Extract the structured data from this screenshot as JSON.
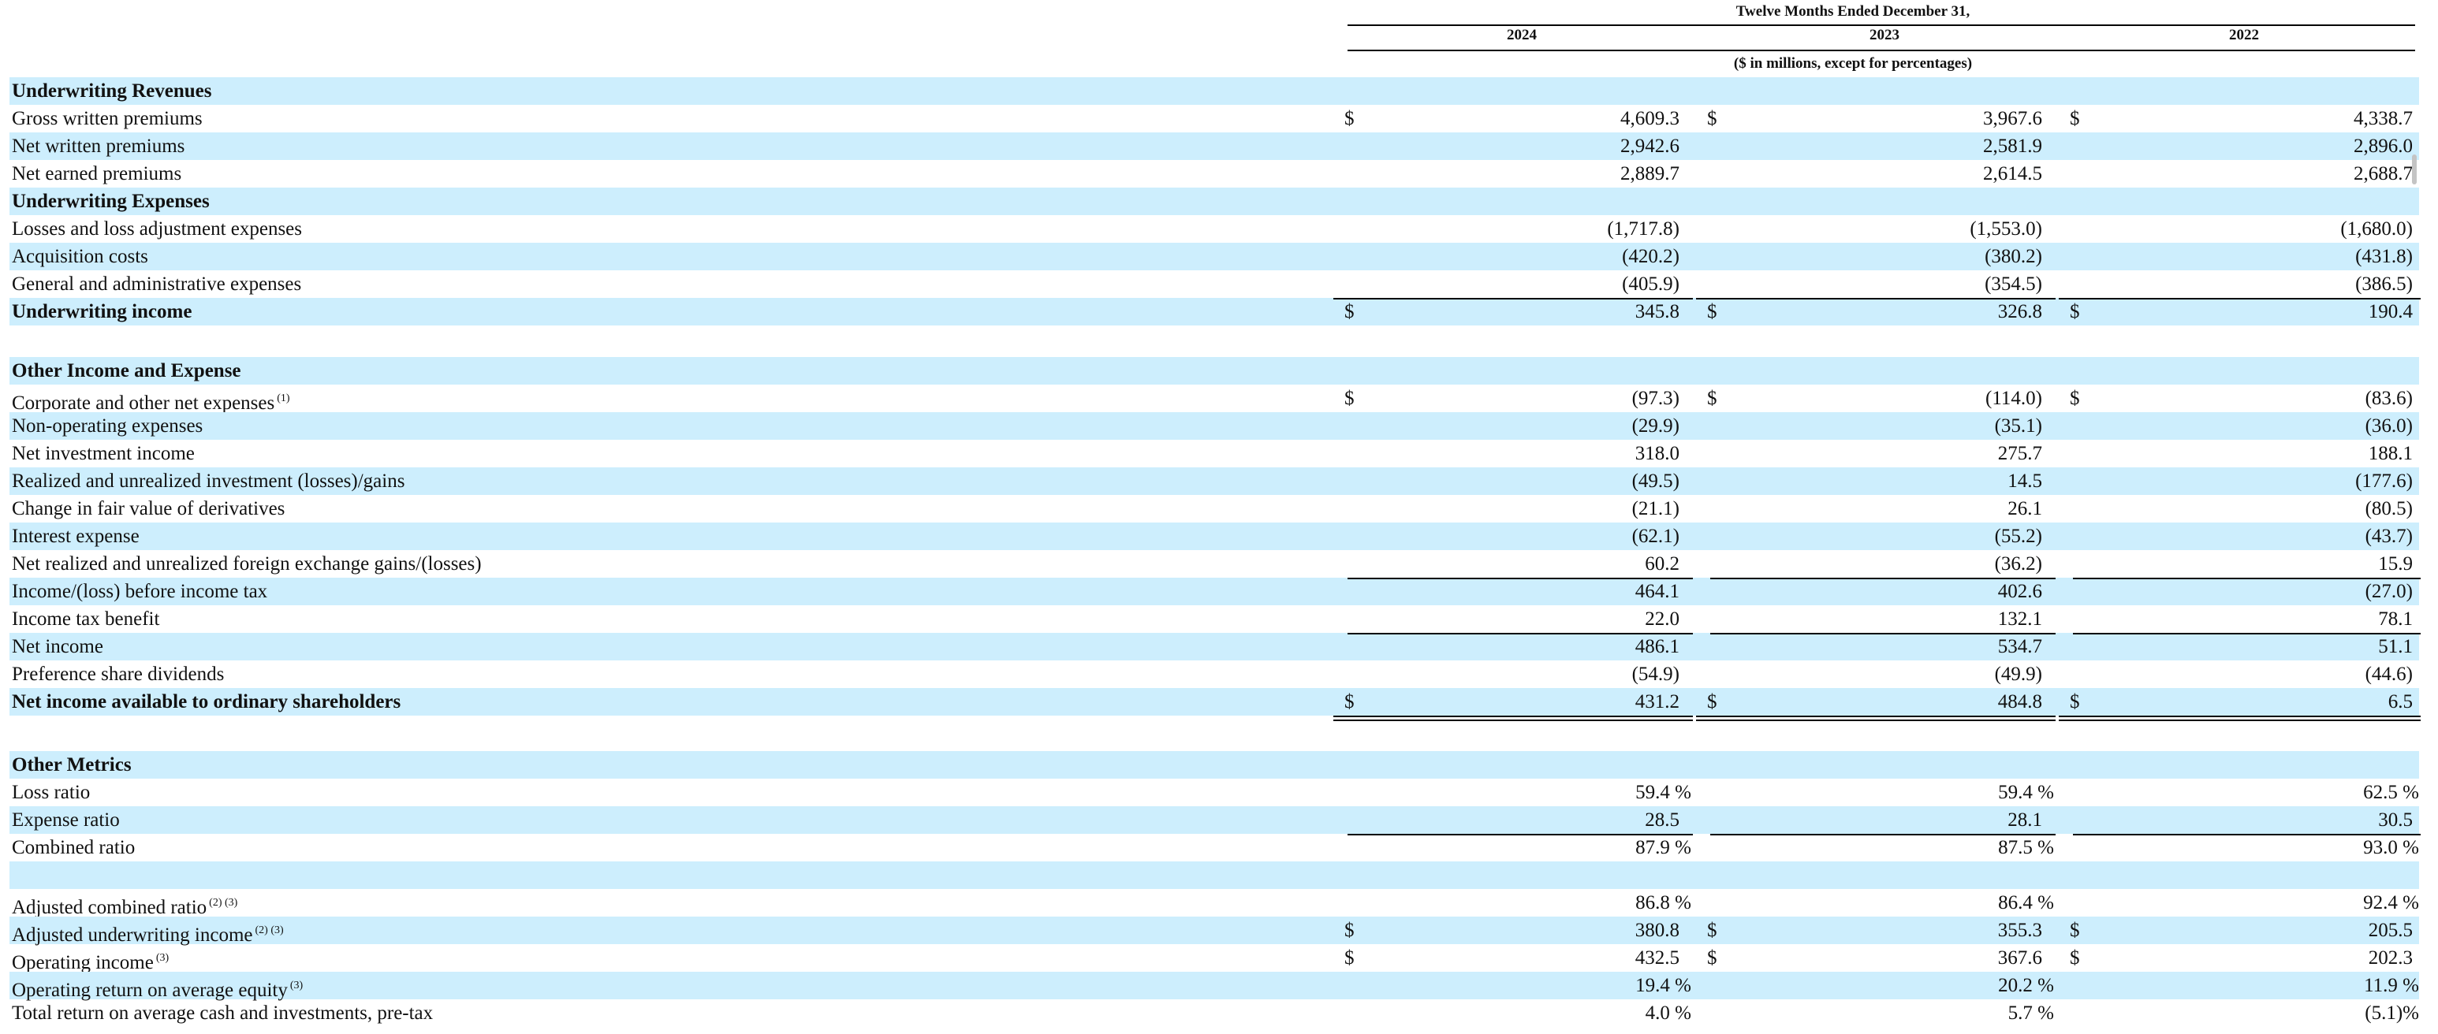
{
  "header": {
    "period_title": "Twelve Months Ended December 31,",
    "years": [
      "2024",
      "2023",
      "2022"
    ],
    "units": "($ in millions, except for percentages)"
  },
  "rows": [
    {
      "label": "Underwriting Revenues",
      "bold": true,
      "shade": true
    },
    {
      "label": "Gross written premiums",
      "shade": false,
      "dollar": true,
      "values": [
        "4,609.3",
        "3,967.6",
        "4,338.7"
      ]
    },
    {
      "label": "Net written premiums",
      "shade": true,
      "values": [
        "2,942.6",
        "2,581.9",
        "2,896.0"
      ]
    },
    {
      "label": "Net earned premiums",
      "shade": false,
      "values": [
        "2,889.7",
        "2,614.5",
        "2,688.7"
      ]
    },
    {
      "label": "Underwriting Expenses",
      "bold": true,
      "shade": true
    },
    {
      "label": "Losses and loss adjustment expenses",
      "shade": false,
      "values": [
        "(1,717.8)",
        "(1,553.0)",
        "(1,680.0)"
      ]
    },
    {
      "label": "Acquisition costs",
      "shade": true,
      "values": [
        "(420.2)",
        "(380.2)",
        "(431.8)"
      ]
    },
    {
      "label": "General and administrative expenses",
      "shade": false,
      "values": [
        "(405.9)",
        "(354.5)",
        "(386.5)"
      ]
    },
    {
      "label": "Underwriting income",
      "bold": true,
      "shade": true,
      "dollar": true,
      "values": [
        "345.8",
        "326.8",
        "190.4"
      ]
    },
    {
      "label": "",
      "shade": false,
      "spacer": true
    },
    {
      "label": "Other Income and Expense",
      "bold": true,
      "shade": true
    },
    {
      "label": "Corporate and other net expenses",
      "note": "(1)",
      "shade": false,
      "dollar": true,
      "values": [
        "(97.3)",
        "(114.0)",
        "(83.6)"
      ]
    },
    {
      "label": "Non-operating expenses",
      "shade": true,
      "values": [
        "(29.9)",
        "(35.1)",
        "(36.0)"
      ]
    },
    {
      "label": "Net investment income",
      "shade": false,
      "values": [
        "318.0",
        "275.7",
        "188.1"
      ]
    },
    {
      "label": "Realized and unrealized investment (losses)/gains",
      "shade": true,
      "values": [
        "(49.5)",
        "14.5",
        "(177.6)"
      ]
    },
    {
      "label": "Change in fair value of derivatives",
      "shade": false,
      "values": [
        "(21.1)",
        "26.1",
        "(80.5)"
      ]
    },
    {
      "label": "Interest expense",
      "shade": true,
      "values": [
        "(62.1)",
        "(55.2)",
        "(43.7)"
      ]
    },
    {
      "label": "Net realized and unrealized foreign exchange gains/(losses)",
      "shade": false,
      "values": [
        "60.2",
        "(36.2)",
        "15.9"
      ]
    },
    {
      "label": "Income/(loss) before income tax",
      "shade": true,
      "values": [
        "464.1",
        "402.6",
        "(27.0)"
      ]
    },
    {
      "label": "Income tax benefit",
      "shade": false,
      "values": [
        "22.0",
        "132.1",
        "78.1"
      ]
    },
    {
      "label": "Net income",
      "shade": true,
      "values": [
        "486.1",
        "534.7",
        "51.1"
      ]
    },
    {
      "label": "Preference share dividends",
      "shade": false,
      "values": [
        "(54.9)",
        "(49.9)",
        "(44.6)"
      ]
    },
    {
      "label": "Net income available to ordinary shareholders",
      "bold": true,
      "shade": true,
      "dollar": true,
      "values": [
        "431.2",
        "484.8",
        "6.5"
      ]
    },
    {
      "label": "",
      "shade": false,
      "spacer": true
    },
    {
      "label": "Other Metrics",
      "bold": true,
      "shade": true
    },
    {
      "label": "Loss ratio",
      "shade": false,
      "values": [
        "59.4 %",
        "59.4 %",
        "62.5 %"
      ]
    },
    {
      "label": "Expense ratio",
      "shade": true,
      "values": [
        "28.5",
        "28.1",
        "30.5"
      ]
    },
    {
      "label": "Combined ratio",
      "shade": false,
      "values": [
        "87.9 %",
        "87.5 %",
        "93.0 %"
      ]
    },
    {
      "label": "",
      "shade": true,
      "spacer": true
    },
    {
      "label": "Adjusted combined ratio",
      "note": "(2) (3)",
      "shade": false,
      "values": [
        "86.8 %",
        "86.4 %",
        "92.4 %"
      ]
    },
    {
      "label": "Adjusted underwriting income",
      "note": "(2) (3)",
      "shade": true,
      "dollar": true,
      "values": [
        "380.8",
        "355.3",
        "205.5"
      ]
    },
    {
      "label": "Operating income",
      "note": "(3)",
      "shade": false,
      "dollar": true,
      "values": [
        "432.5",
        "367.6",
        "202.3"
      ]
    },
    {
      "label": "Operating return on average equity",
      "note": "(3)",
      "shade": true,
      "values": [
        "19.4 %",
        "20.2 %",
        "11.9 %"
      ]
    },
    {
      "label": "Total return on average cash and investments, pre-tax",
      "shade": false,
      "values": [
        "4.0 %",
        "5.7 %",
        "(5.1)%"
      ]
    }
  ]
}
